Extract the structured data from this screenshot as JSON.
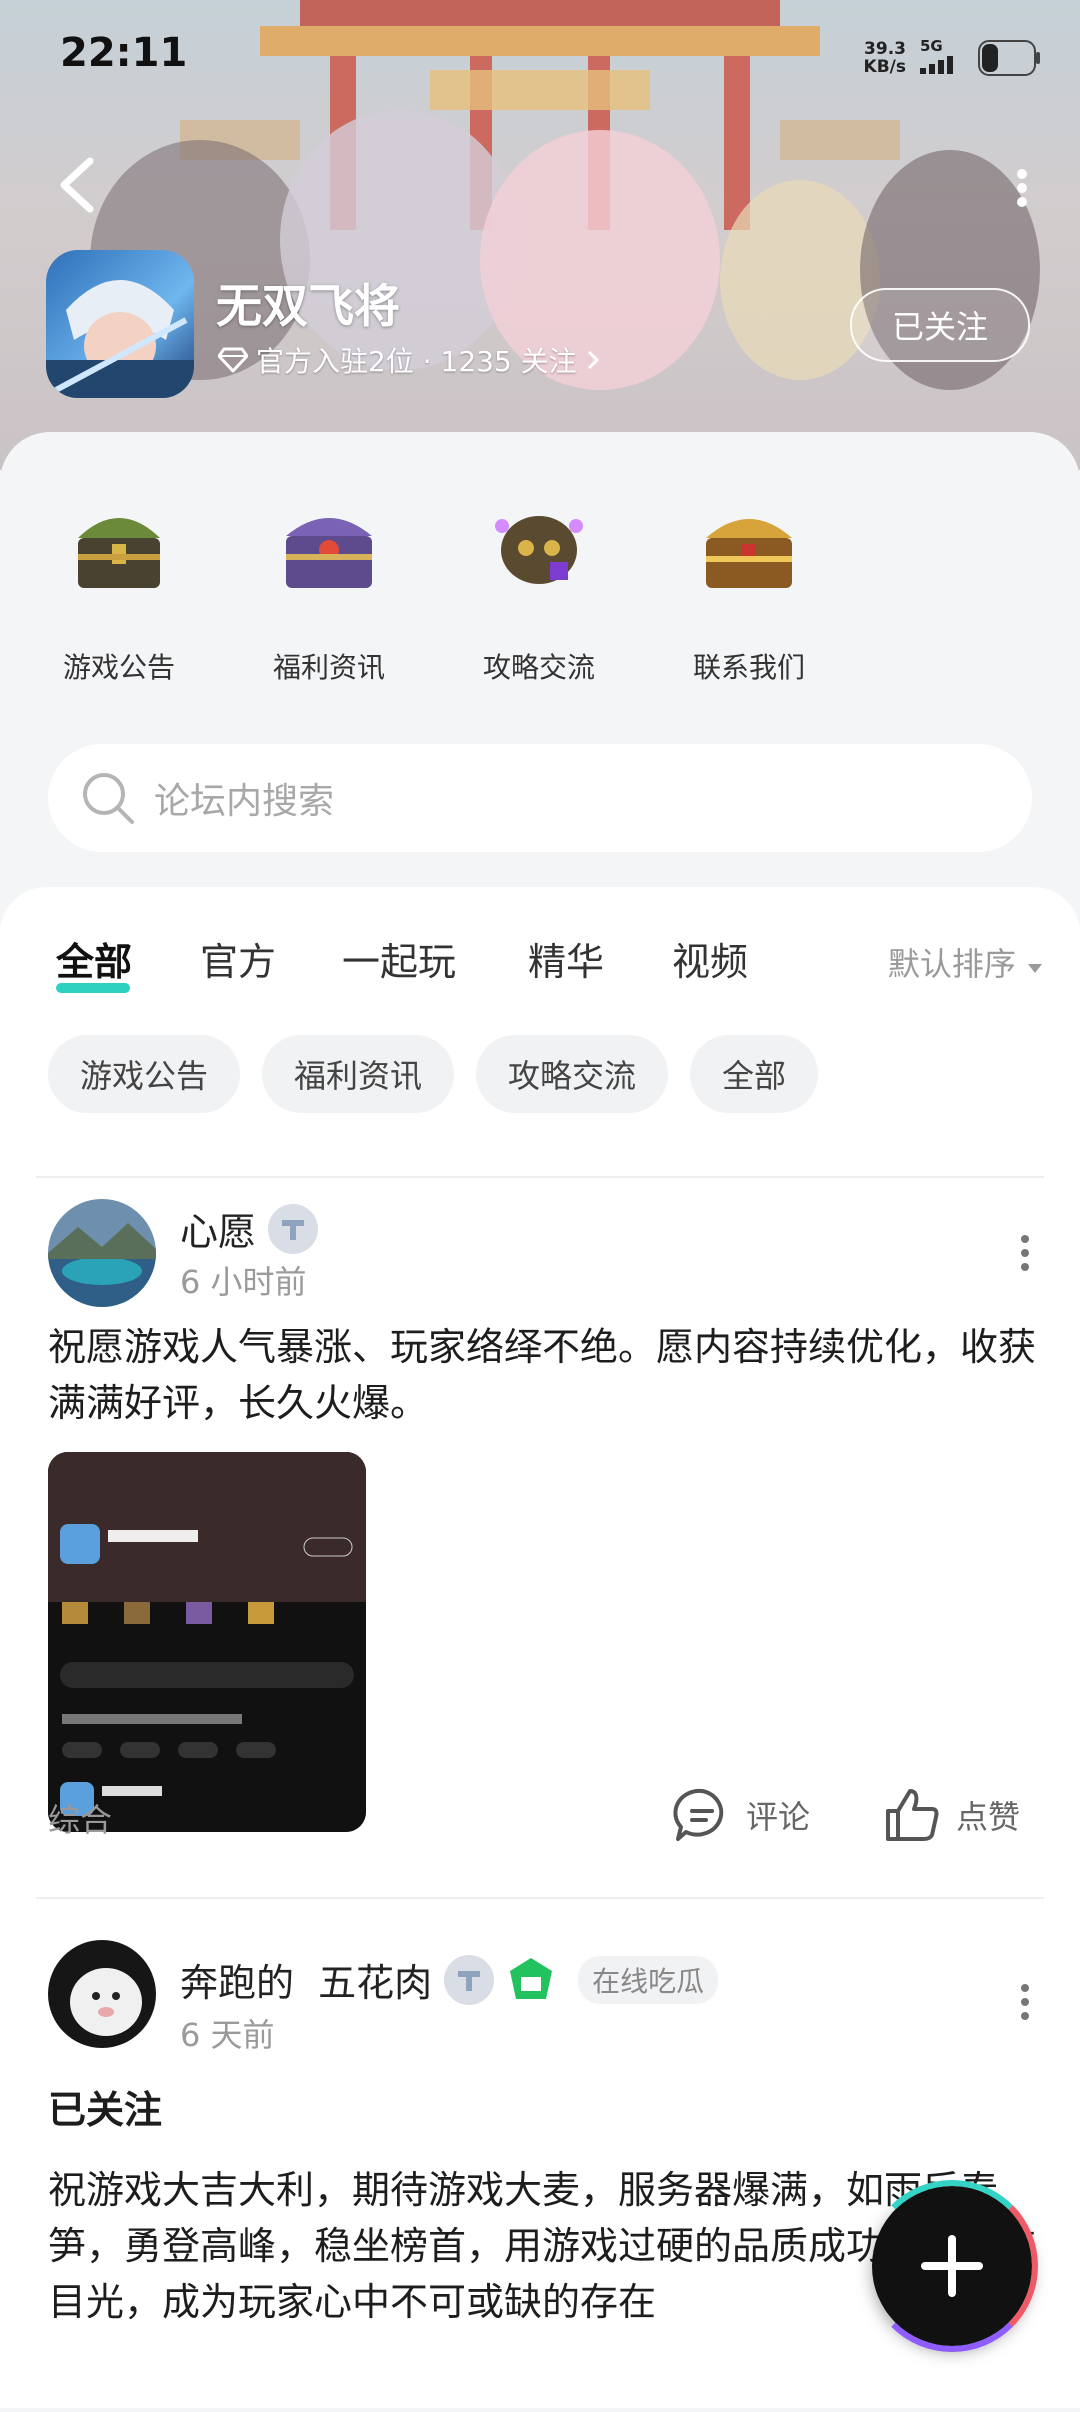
{
  "status_bar": {
    "time": "22:11",
    "net_speed": "39.3",
    "net_unit": "KB/s",
    "network": "5G"
  },
  "header": {
    "app_name": "无双飞将",
    "meta_text": "官方入驻2位 · 1235 关注",
    "follow_label": "已关注",
    "icons": {
      "back": "back-icon",
      "more": "more-vertical-icon",
      "verified": "diamond-icon"
    }
  },
  "quick_links": [
    {
      "label": "游戏公告",
      "icon": "chest-green-icon"
    },
    {
      "label": "福利资讯",
      "icon": "chest-purple-icon"
    },
    {
      "label": "攻略交流",
      "icon": "chest-skull-icon"
    },
    {
      "label": "联系我们",
      "icon": "chest-gold-icon"
    }
  ],
  "search": {
    "placeholder": "论坛内搜索"
  },
  "tabs": [
    {
      "label": "全部",
      "active": true
    },
    {
      "label": "官方",
      "active": false
    },
    {
      "label": "一起玩",
      "active": false
    },
    {
      "label": "精华",
      "active": false
    },
    {
      "label": "视频",
      "active": false
    }
  ],
  "sort_label": "默认排序",
  "chips": [
    "游戏公告",
    "福利资讯",
    "攻略交流",
    "全部"
  ],
  "posts": [
    {
      "author": "心愿",
      "time": "6 小时前",
      "content": "祝愿游戏人气暴涨、玩家络绎不绝。愿内容持续优化，收获满满好评，长久火爆。",
      "tag": "综合",
      "comment_label": "评论",
      "like_label": "点赞"
    },
    {
      "author": "奔跑的  五花肉",
      "status": "在线吃瓜",
      "time": "6 天前",
      "follow_state": "已关注",
      "content": "祝游戏大吉大利，期待游戏大麦，服务器爆满，如雨后春笋，勇登高峰，稳坐榜首，用游戏过硬的品质成功吸引所有目光，成为玩家心中不可或缺的存在"
    }
  ],
  "colors": {
    "accent": "#2ed0c0",
    "fab": "#111111"
  }
}
